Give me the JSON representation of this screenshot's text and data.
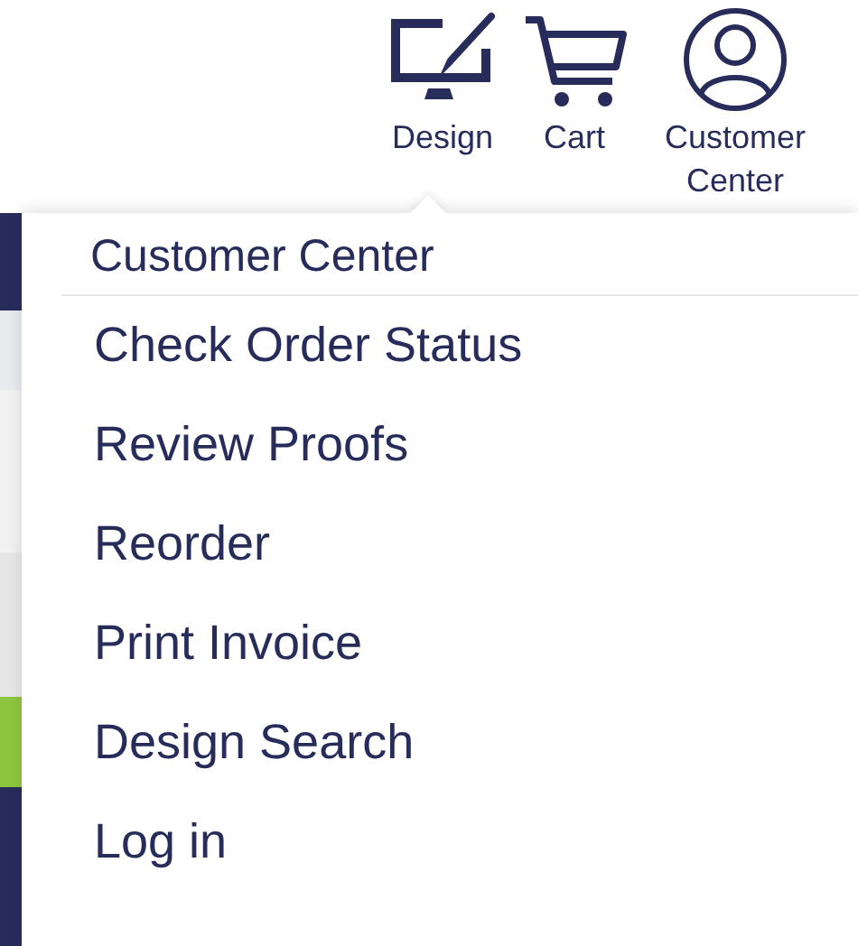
{
  "nav": [
    {
      "kind": "design",
      "label": "Design"
    },
    {
      "kind": "cart",
      "label": "Cart"
    },
    {
      "kind": "account",
      "label": "Customer Center"
    }
  ],
  "dropdown": {
    "title": "Customer Center",
    "items": [
      "Check Order Status",
      "Review Proofs",
      "Reorder",
      "Print Invoice",
      "Design Search",
      "Log in"
    ]
  }
}
